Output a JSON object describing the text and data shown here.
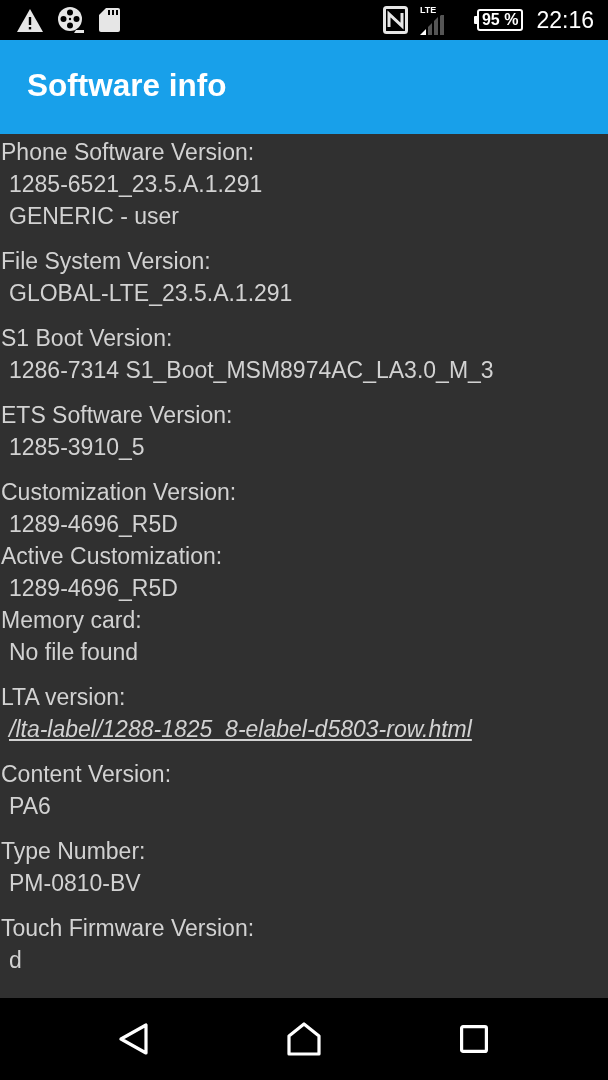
{
  "status_bar": {
    "network": "LTE",
    "battery": "95 %",
    "time": "22:16"
  },
  "app_bar": {
    "title": "Software info"
  },
  "sections": [
    {
      "entries": [
        {
          "label": "Phone Software Version:",
          "kind": "text",
          "values": [
            "1285-6521_23.5.A.1.291",
            "GENERIC - user"
          ]
        }
      ]
    },
    {
      "entries": [
        {
          "label": "File System Version:",
          "kind": "text",
          "values": [
            "GLOBAL-LTE_23.5.A.1.291"
          ]
        }
      ]
    },
    {
      "entries": [
        {
          "label": "S1 Boot Version:",
          "kind": "text",
          "values": [
            "1286-7314 S1_Boot_MSM8974AC_LA3.0_M_3"
          ]
        }
      ]
    },
    {
      "entries": [
        {
          "label": "ETS Software Version:",
          "kind": "text",
          "values": [
            "1285-3910_5"
          ]
        }
      ]
    },
    {
      "entries": [
        {
          "label": "Customization Version:",
          "kind": "text",
          "values": [
            "1289-4696_R5D"
          ]
        },
        {
          "label": "Active Customization:",
          "kind": "text",
          "values": [
            "1289-4696_R5D"
          ]
        },
        {
          "label": "Memory card:",
          "kind": "text",
          "values": [
            "No file found"
          ]
        }
      ]
    },
    {
      "entries": [
        {
          "label": "LTA version:",
          "kind": "link",
          "values": [
            "/lta-label/1288-1825_8-elabel-d5803-row.html"
          ]
        }
      ]
    },
    {
      "entries": [
        {
          "label": "Content Version:",
          "kind": "text",
          "values": [
            "PA6"
          ]
        }
      ]
    },
    {
      "entries": [
        {
          "label": "Type Number:",
          "kind": "text",
          "values": [
            "PM-0810-BV"
          ]
        }
      ]
    },
    {
      "entries": [
        {
          "label": "Touch Firmware Version:",
          "kind": "text",
          "values": [
            "d"
          ]
        }
      ]
    }
  ]
}
